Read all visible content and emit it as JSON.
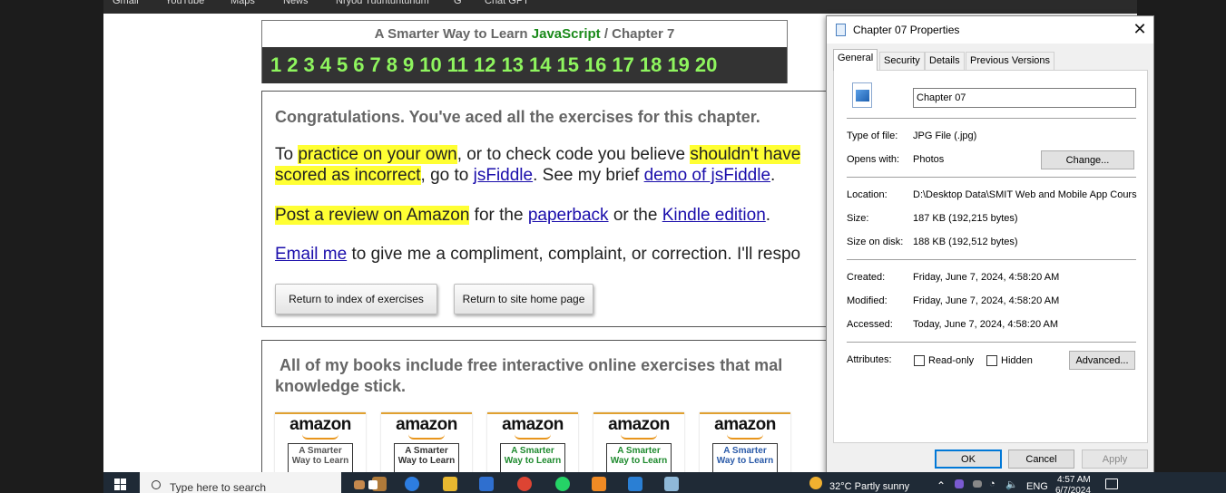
{
  "bookmarks": [
    "Gmail",
    "YouTube",
    "Maps",
    "News",
    "Nryod Tuuntuntunum",
    "G",
    "Chat GPT"
  ],
  "chapter_header": {
    "prefix": "A Smarter Way to Learn ",
    "highlight": "JavaScript",
    "suffix": " / Chapter 7",
    "numbers": [
      "1",
      "2",
      "3",
      "4",
      "5",
      "6",
      "7",
      "8",
      "9",
      "10",
      "11",
      "12",
      "13",
      "14",
      "15",
      "16",
      "17",
      "18",
      "19",
      "20"
    ]
  },
  "congrats": {
    "title": "Congratulations. You've aced all the exercises for this chapter.",
    "p1": {
      "t1": "To ",
      "h1": "practice on your own",
      "t2": ", or to check code you believe ",
      "h2": "shouldn't have",
      "h3": "scored as incorrect",
      "t3": ", go to ",
      "l1": "jsFiddle",
      "t4": ". See my brief ",
      "l2": "demo of jsFiddle",
      "t5": "."
    },
    "p2": {
      "h1": "Post a review on Amazon",
      "t1": " for the ",
      "l1": "paperback",
      "t2": " or the ",
      "l2": "Kindle edition",
      "t3": "."
    },
    "p3": {
      "l1": "Email me",
      "t1": " to give me a compliment, complaint, or correction. I'll respo"
    },
    "buttons": {
      "index": "Return to index of exercises",
      "home": "Return to site home page"
    }
  },
  "books": {
    "title_line1": "All of my books include free interactive online exercises that mal",
    "title_line2": "knowledge stick.",
    "items": [
      {
        "brand": "amazon",
        "cover": "A Smarter Way to Learn",
        "color": "#555555"
      },
      {
        "brand": "amazon",
        "cover": "A Smarter Way to Learn",
        "color": "#333333"
      },
      {
        "brand": "amazon",
        "cover": "A Smarter Way to Learn",
        "color": "#1e8a2e"
      },
      {
        "brand": "amazon",
        "cover": "A Smarter Way to Learn",
        "color": "#1e8a2e"
      },
      {
        "brand": "amazon",
        "cover": "A Smarter Way to Learn",
        "color": "#2a5aa8"
      }
    ]
  },
  "dialog": {
    "title": "Chapter 07 Properties",
    "close": "✕",
    "tabs": [
      "General",
      "Security",
      "Details",
      "Previous Versions"
    ],
    "file_name": "Chapter 07",
    "type_label": "Type of file:",
    "type_value": "JPG File (.jpg)",
    "opens_label": "Opens with:",
    "opens_value": "Photos",
    "change_button": "Change...",
    "location_label": "Location:",
    "location_value": "D:\\Desktop Data\\SMIT Web and Mobile App Cours",
    "size_label": "Size:",
    "size_value": "187 KB (192,215 bytes)",
    "disk_label": "Size on disk:",
    "disk_value": "188 KB (192,512 bytes)",
    "created_label": "Created:",
    "created_value": "Friday, June 7, 2024, 4:58:20 AM",
    "modified_label": "Modified:",
    "modified_value": "Friday, June 7, 2024, 4:58:20 AM",
    "accessed_label": "Accessed:",
    "accessed_value": "Today, June 7, 2024, 4:58:20 AM",
    "attributes_label": "Attributes:",
    "readonly_label": "Read-only",
    "hidden_label": "Hidden",
    "advanced_button": "Advanced...",
    "ok_button": "OK",
    "cancel_button": "Cancel",
    "apply_button": "Apply"
  },
  "taskbar": {
    "search_placeholder": "Type here to search",
    "weather": "32°C  Partly sunny",
    "language": "ENG",
    "time": "4:57 AM",
    "date": "6/7/2024"
  }
}
